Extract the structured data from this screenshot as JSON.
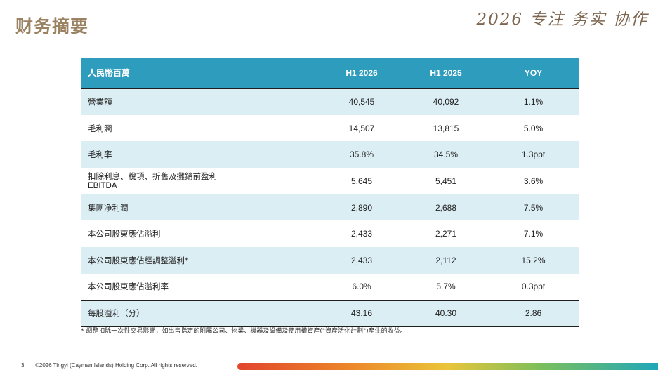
{
  "page": {
    "title": "财务摘要",
    "slogan": "2026 专注 务实 协作"
  },
  "table": {
    "header": [
      "人民幣百萬",
      "H1 2026",
      "H1 2025",
      "YOY"
    ],
    "rows": [
      {
        "label": "營業額",
        "sub": "",
        "h1_2026": "40,545",
        "h1_2025": "40,092",
        "yoy": "1.1%"
      },
      {
        "label": "毛利潤",
        "sub": "",
        "h1_2026": "14,507",
        "h1_2025": "13,815",
        "yoy": "5.0%"
      },
      {
        "label": "毛利率",
        "sub": "",
        "h1_2026": "35.8%",
        "h1_2025": "34.5%",
        "yoy": "1.3ppt"
      },
      {
        "label": "扣除利息、稅項、折舊及攤銷前盈利",
        "sub": "EBITDA",
        "h1_2026": "5,645",
        "h1_2025": "5,451",
        "yoy": "3.6%"
      },
      {
        "label": "集團净利潤",
        "sub": "",
        "h1_2026": "2,890",
        "h1_2025": "2,688",
        "yoy": "7.5%"
      },
      {
        "label": "本公司股東應佔溢利",
        "sub": "",
        "h1_2026": "2,433",
        "h1_2025": "2,271",
        "yoy": "7.1%"
      },
      {
        "label": "本公司股東應佔經調整溢利*",
        "sub": "",
        "h1_2026": "2,433",
        "h1_2025": "2,112",
        "yoy": "15.2%"
      },
      {
        "label": "本公司股東應佔溢利率",
        "sub": "",
        "h1_2026": "6.0%",
        "h1_2025": "5.7%",
        "yoy": "0.3ppt"
      },
      {
        "label": "每股溢利（分）",
        "sub": "",
        "h1_2026": "43.16",
        "h1_2025": "40.30",
        "yoy": "2.86"
      }
    ]
  },
  "footnote": "* 調整扣除一次性交易影響，如出售指定的附屬公司、物業、機器及設備及使用權資產(\"資產活化計劃\")產生的收益。",
  "footer": {
    "page_number": "3",
    "copyright": "©2026 Tingyi (Cayman Islands) Holding Corp. All rights reserved."
  }
}
